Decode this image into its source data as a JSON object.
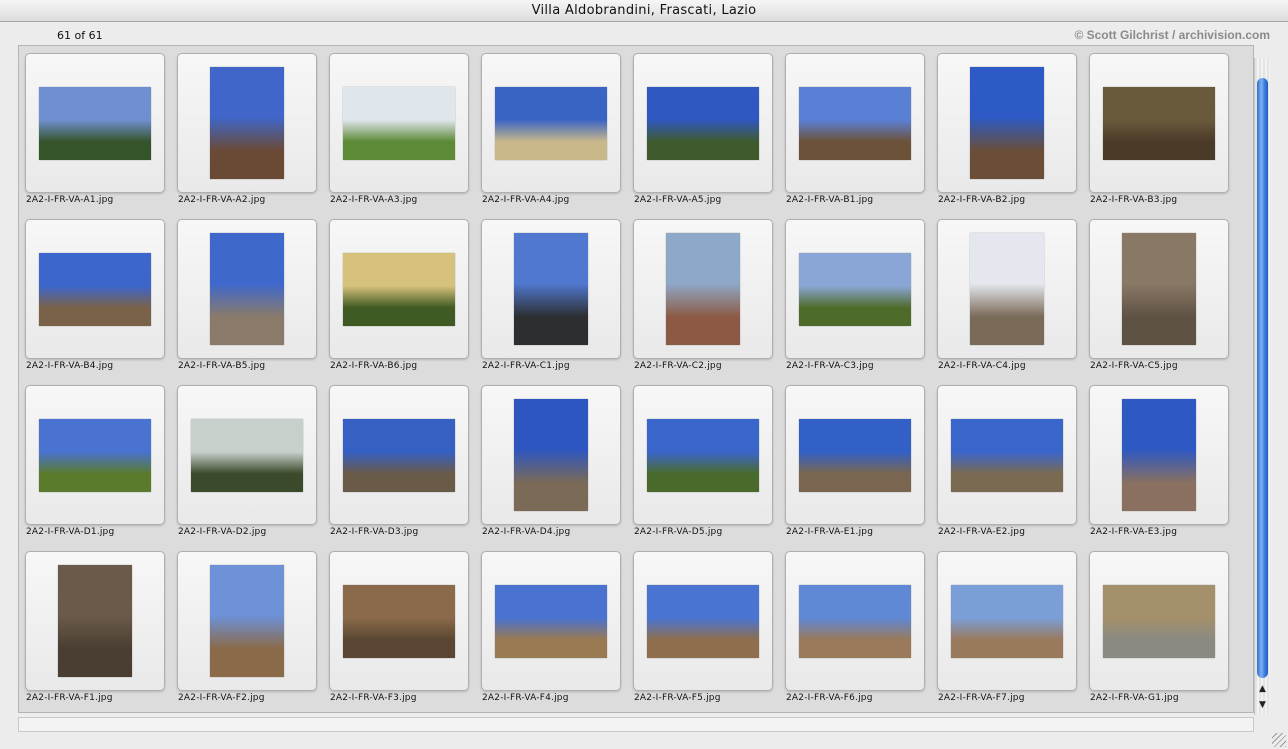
{
  "window": {
    "title": "Villa Aldobrandini, Frascati, Lazio"
  },
  "header": {
    "count": "61 of 61",
    "copyright": "© Scott Gilchrist / archivision.com"
  },
  "thumbnails": [
    {
      "name": "2A2-I-FR-VA-A1.jpg",
      "orient": "land",
      "sky": "#6f8fd0",
      "ground": "#36542a"
    },
    {
      "name": "2A2-I-FR-VA-A2.jpg",
      "orient": "port",
      "sky": "#3f66c8",
      "ground": "#6a4a34"
    },
    {
      "name": "2A2-I-FR-VA-A3.jpg",
      "orient": "land",
      "sky": "#dfe6ec",
      "ground": "#5d8a36"
    },
    {
      "name": "2A2-I-FR-VA-A4.jpg",
      "orient": "land",
      "sky": "#3a64c4",
      "ground": "#c9b98a"
    },
    {
      "name": "2A2-I-FR-VA-A5.jpg",
      "orient": "land",
      "sky": "#2f58c0",
      "ground": "#3f5a2c"
    },
    {
      "name": "2A2-I-FR-VA-B1.jpg",
      "orient": "land",
      "sky": "#5a80d6",
      "ground": "#6c5238"
    },
    {
      "name": "2A2-I-FR-VA-B2.jpg",
      "orient": "port",
      "sky": "#2d5ac4",
      "ground": "#6a4e38"
    },
    {
      "name": "2A2-I-FR-VA-B3.jpg",
      "orient": "land",
      "sky": "#6a5a3c",
      "ground": "#4a3a28"
    },
    {
      "name": "2A2-I-FR-VA-B4.jpg",
      "orient": "land",
      "sky": "#3c66cc",
      "ground": "#7a6248"
    },
    {
      "name": "2A2-I-FR-VA-B5.jpg",
      "orient": "port",
      "sky": "#3e68cc",
      "ground": "#8a7a6a"
    },
    {
      "name": "2A2-I-FR-VA-B6.jpg",
      "orient": "land",
      "sky": "#d6c27a",
      "ground": "#3f5a22"
    },
    {
      "name": "2A2-I-FR-VA-C1.jpg",
      "orient": "port",
      "sky": "#5078d0",
      "ground": "#2c2e30"
    },
    {
      "name": "2A2-I-FR-VA-C2.jpg",
      "orient": "port",
      "sky": "#8ea8c8",
      "ground": "#8c5a44"
    },
    {
      "name": "2A2-I-FR-VA-C3.jpg",
      "orient": "land",
      "sky": "#8aa6d6",
      "ground": "#4f6b2a"
    },
    {
      "name": "2A2-I-FR-VA-C4.jpg",
      "orient": "port",
      "sky": "#e4e8ee",
      "ground": "#7a6a58"
    },
    {
      "name": "2A2-I-FR-VA-C5.jpg",
      "orient": "port",
      "sky": "#8a7866",
      "ground": "#5e5244"
    },
    {
      "name": "2A2-I-FR-VA-D1.jpg",
      "orient": "land",
      "sky": "#4a72d0",
      "ground": "#5a7a2c"
    },
    {
      "name": "2A2-I-FR-VA-D2.jpg",
      "orient": "land",
      "sky": "#c8d0cc",
      "ground": "#3a4a2a"
    },
    {
      "name": "2A2-I-FR-VA-D3.jpg",
      "orient": "land",
      "sky": "#3660c4",
      "ground": "#6a5a48"
    },
    {
      "name": "2A2-I-FR-VA-D4.jpg",
      "orient": "port",
      "sky": "#2e56c0",
      "ground": "#7a6a56"
    },
    {
      "name": "2A2-I-FR-VA-D5.jpg",
      "orient": "land",
      "sky": "#3a66cc",
      "ground": "#4a6a2c"
    },
    {
      "name": "2A2-I-FR-VA-E1.jpg",
      "orient": "land",
      "sky": "#3360c6",
      "ground": "#7a6650"
    },
    {
      "name": "2A2-I-FR-VA-E2.jpg",
      "orient": "land",
      "sky": "#3a66cc",
      "ground": "#7a6a52"
    },
    {
      "name": "2A2-I-FR-VA-E3.jpg",
      "orient": "port",
      "sky": "#2e58c2",
      "ground": "#8a7060"
    },
    {
      "name": "2A2-I-FR-VA-F1.jpg",
      "orient": "port",
      "sky": "#6a5a4a",
      "ground": "#4a3e32"
    },
    {
      "name": "2A2-I-FR-VA-F2.jpg",
      "orient": "port",
      "sky": "#6d92d8",
      "ground": "#8a6a48"
    },
    {
      "name": "2A2-I-FR-VA-F3.jpg",
      "orient": "land",
      "sky": "#8a6a4a",
      "ground": "#5a4632"
    },
    {
      "name": "2A2-I-FR-VA-F4.jpg",
      "orient": "land",
      "sky": "#4a72d0",
      "ground": "#9a7a52"
    },
    {
      "name": "2A2-I-FR-VA-F5.jpg",
      "orient": "land",
      "sky": "#4a74d2",
      "ground": "#8e6e4c"
    },
    {
      "name": "2A2-I-FR-VA-F6.jpg",
      "orient": "land",
      "sky": "#5f88d6",
      "ground": "#9a7a5a"
    },
    {
      "name": "2A2-I-FR-VA-F7.jpg",
      "orient": "land",
      "sky": "#7a9ed8",
      "ground": "#9a7a5c"
    },
    {
      "name": "2A2-I-FR-VA-G1.jpg",
      "orient": "land",
      "sky": "#a4906a",
      "ground": "#8a8a82"
    }
  ]
}
